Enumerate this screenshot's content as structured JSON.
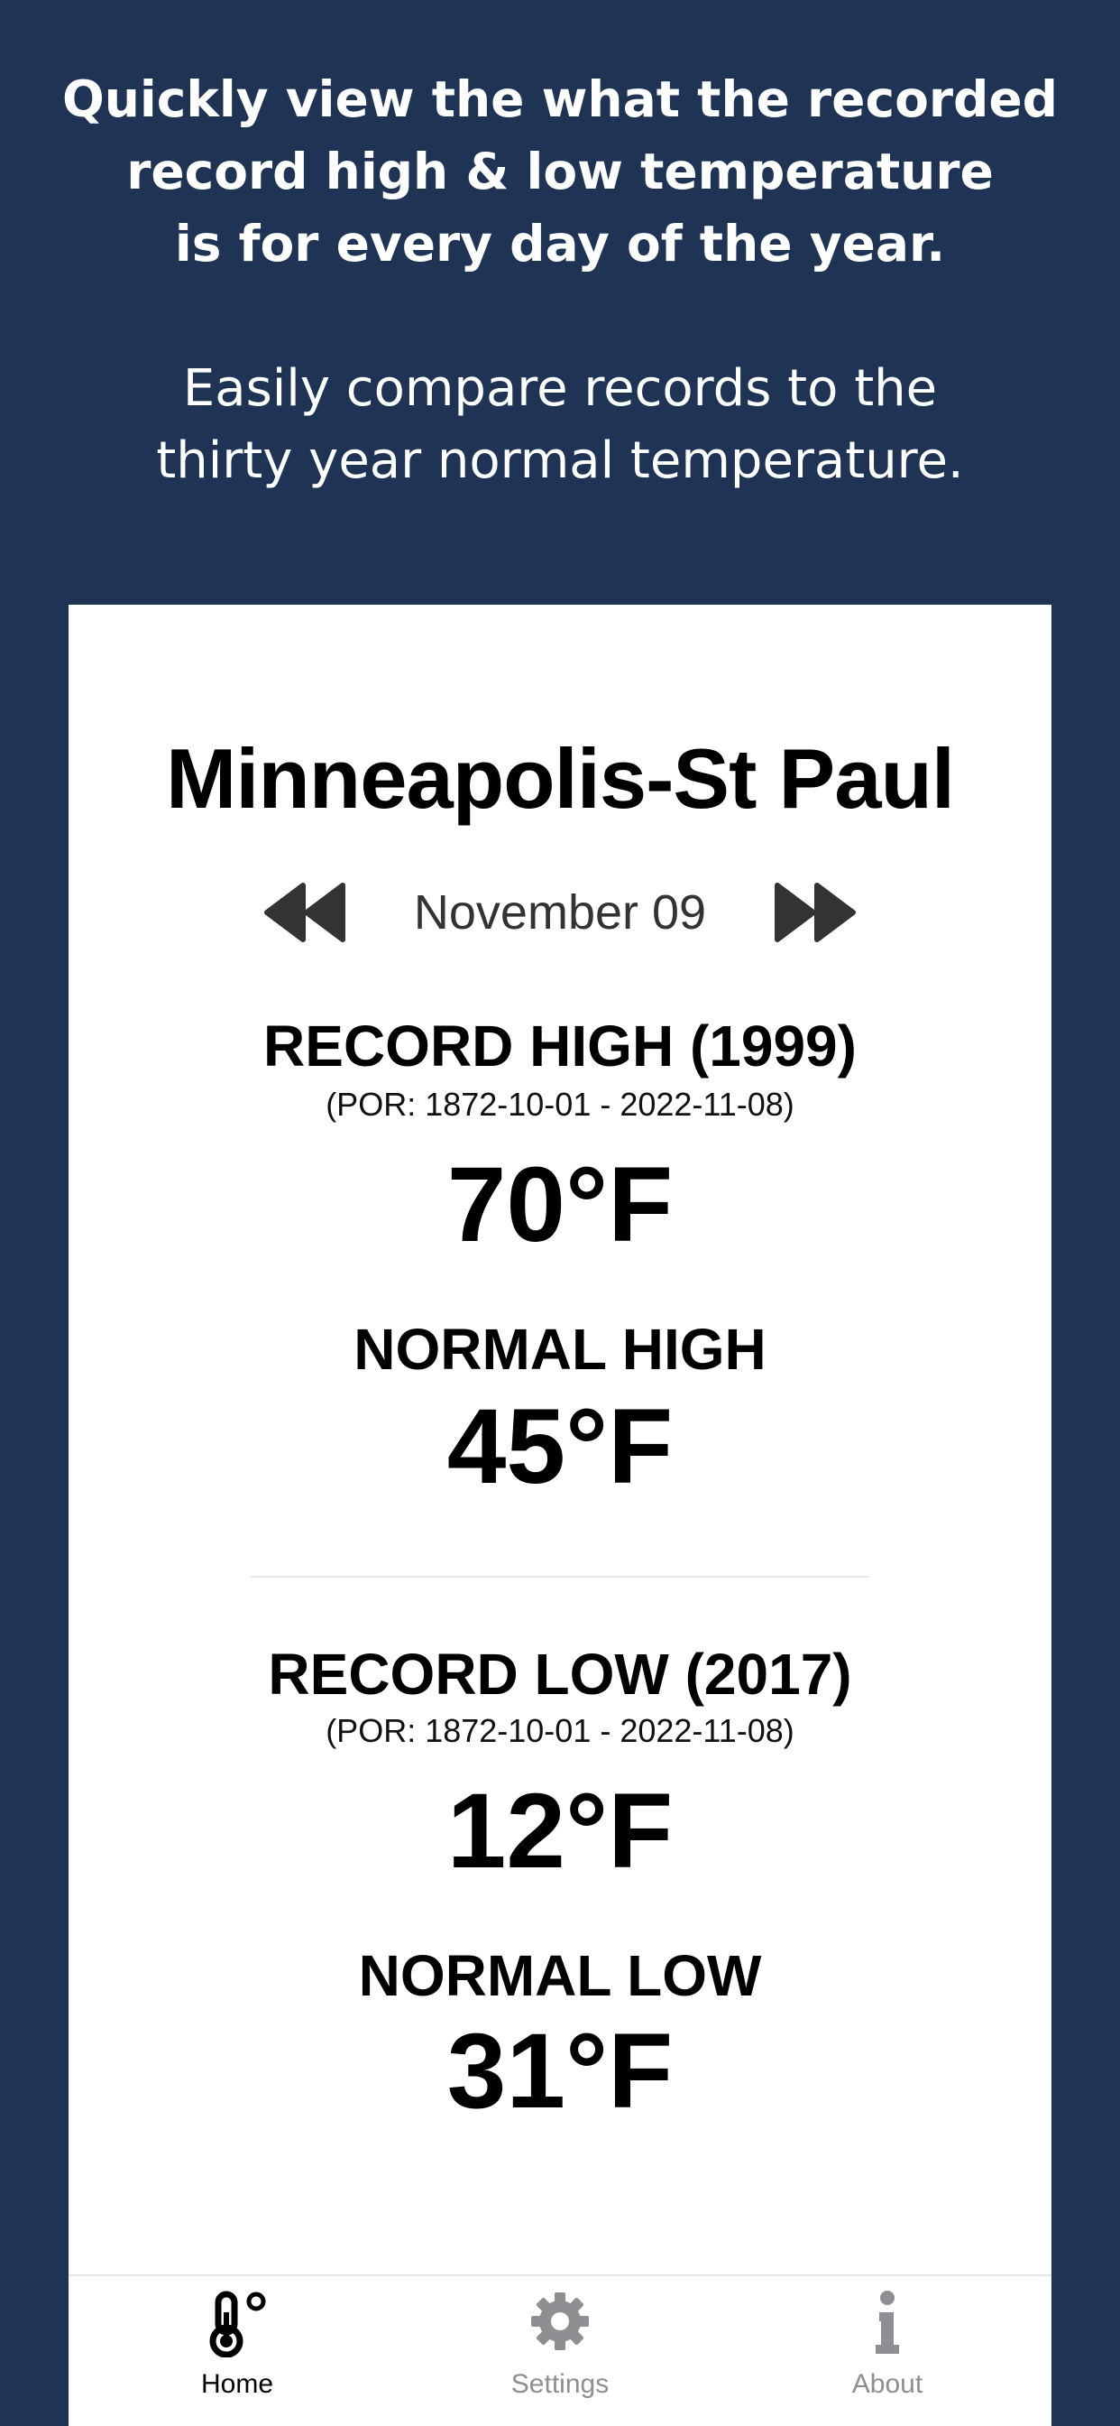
{
  "promo": {
    "line1": "Quickly view the what the recorded",
    "line2": "record high & low temperature",
    "line3": "is for every day of the year.",
    "line4": "Easily compare records to the",
    "line5": "thirty year normal temperature."
  },
  "station": {
    "name": "Minneapolis-St Paul"
  },
  "date": {
    "label": "November 09",
    "prev_icon": "rewind-icon",
    "next_icon": "fast-forward-icon"
  },
  "record_high": {
    "label": "RECORD HIGH (1999)",
    "por": "(POR: 1872-10-01 - 2022-11-08)",
    "value": "70°F"
  },
  "normal_high": {
    "label": "NORMAL HIGH",
    "value": "45°F"
  },
  "record_low": {
    "label": "RECORD LOW (2017)",
    "por": "(POR: 1872-10-01 - 2022-11-08)",
    "value": "12°F"
  },
  "normal_low": {
    "label": "NORMAL LOW",
    "value": "31°F"
  },
  "tabs": [
    {
      "label": "Home",
      "icon": "thermometer-icon",
      "active": true
    },
    {
      "label": "Settings",
      "icon": "gear-icon",
      "active": false
    },
    {
      "label": "About",
      "icon": "info-icon",
      "active": false
    }
  ],
  "colors": {
    "background": "#1f3354",
    "card": "#ffffff",
    "text": "#000000",
    "tab_inactive": "#8e8e93"
  }
}
